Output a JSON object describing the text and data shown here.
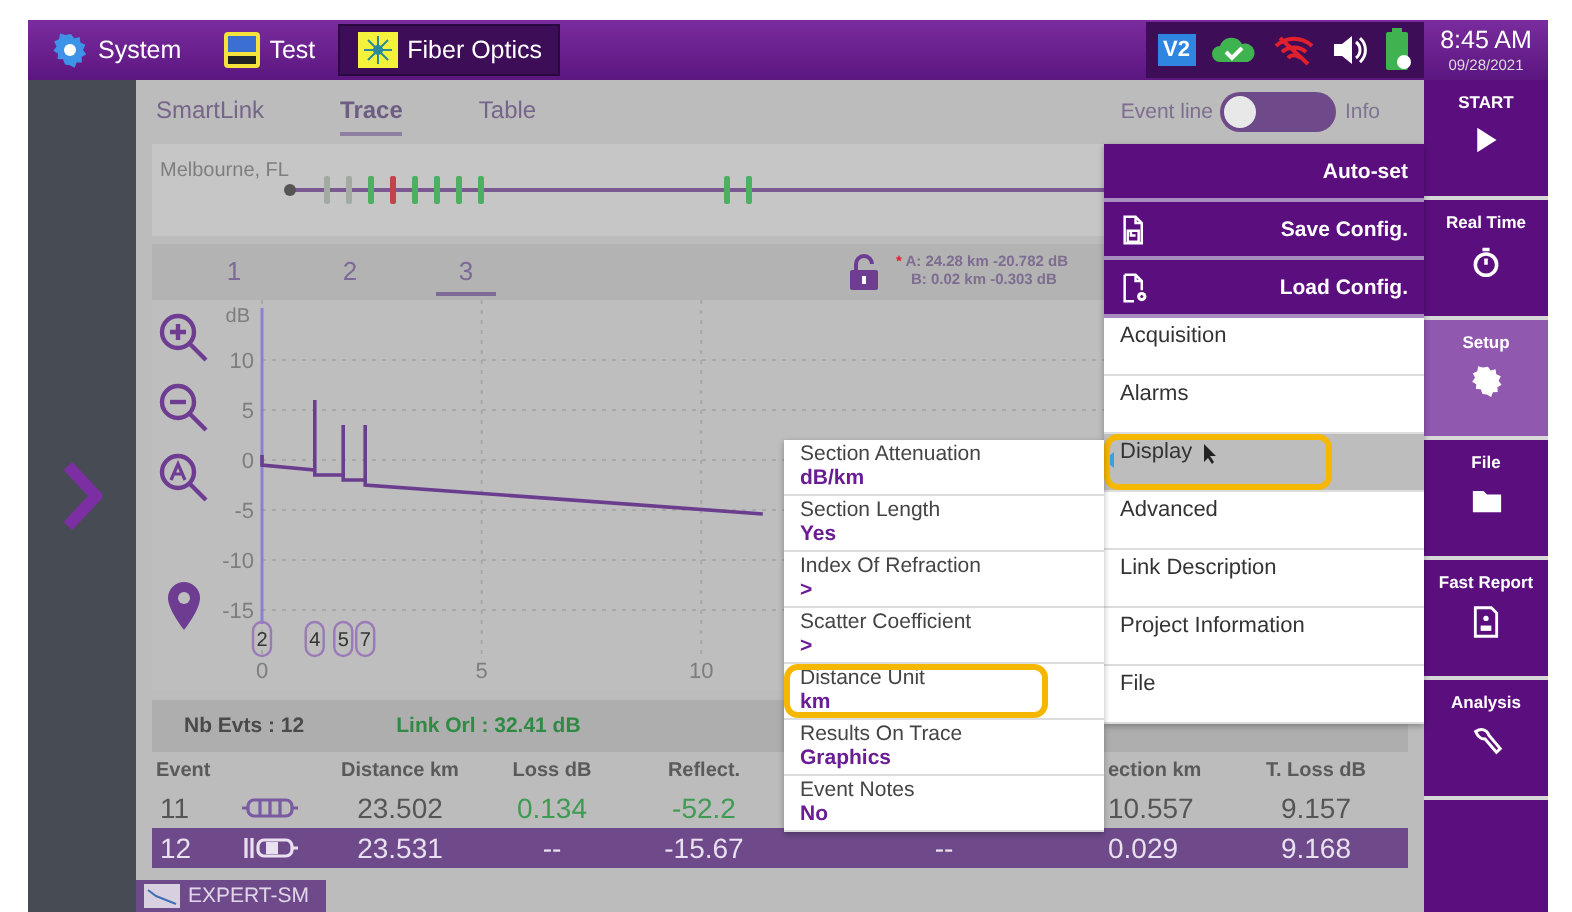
{
  "top_bar": {
    "apps": [
      {
        "label": "System",
        "selected": false
      },
      {
        "label": "Test",
        "selected": false
      },
      {
        "label": "Fiber Optics",
        "selected": true
      }
    ],
    "status": {
      "badge": "V2",
      "time": "8:45 AM",
      "date": "09/28/2021"
    }
  },
  "view_tabs": [
    {
      "label": "SmartLink",
      "selected": false
    },
    {
      "label": "Trace",
      "selected": true
    },
    {
      "label": "Table",
      "selected": false
    }
  ],
  "event_line_toggle": {
    "label": "Event line",
    "on": false,
    "info_label": "Info"
  },
  "link_map": {
    "location": "Melbourne, FL",
    "event_groups": [
      [
        {
          "color": "#a3aaa3"
        },
        {
          "color": "#a3aaa3"
        },
        {
          "color": "#4caf62"
        },
        {
          "color": "#c0444a"
        },
        {
          "color": "#4caf62"
        },
        {
          "color": "#4caf62"
        },
        {
          "color": "#4caf62"
        },
        {
          "color": "#4caf62"
        }
      ],
      [
        {
          "color": "#4caf62"
        },
        {
          "color": "#4caf62"
        }
      ]
    ]
  },
  "trace_tabs": [
    {
      "label": "1",
      "selected": false
    },
    {
      "label": "2",
      "selected": false
    },
    {
      "label": "3",
      "selected": true
    }
  ],
  "cursors": [
    {
      "marker": "*",
      "text": "A: 24.28 km -20.782 dB"
    },
    {
      "text": "B: 0.02 km -0.303 dB"
    }
  ],
  "chart_data": {
    "type": "line",
    "ylabel": "dB",
    "grid": true,
    "xlim": [
      0,
      26
    ],
    "ylim": [
      -20,
      16
    ],
    "xticks": [
      0,
      5,
      10
    ],
    "yticks": [
      10,
      5,
      0,
      -5,
      -10,
      -15
    ],
    "x": [
      0,
      0,
      1.2,
      1.2,
      1.2,
      1.85,
      1.85,
      1.85,
      2.35,
      2.35,
      2.35,
      11.4
    ],
    "series": [
      {
        "color": "#6a3d8f",
        "values": [
          0.5,
          -0.5,
          -1,
          6,
          -1.5,
          -1.5,
          3.5,
          -2,
          -2,
          3.5,
          -2.5,
          -5.4
        ]
      }
    ]
  },
  "trace_event_labels": [
    "2",
    "4",
    "5",
    "7"
  ],
  "summary": {
    "events": "Nb Evts : 12",
    "link_orl": "Link Orl : 32.41 dB"
  },
  "table": {
    "columns": [
      "Event",
      "Distance  km",
      "Loss dB",
      "Reflect.",
      null,
      "ection km",
      "T. Loss dB"
    ],
    "rows": [
      {
        "kind": "connector",
        "pass": true,
        "selected": false,
        "cells": [
          "11",
          "23.502",
          "0.134",
          "-52.2",
          null,
          "10.557",
          "9.157"
        ]
      },
      {
        "kind": "end",
        "pass": false,
        "selected": true,
        "cells": [
          "12",
          "23.531",
          "--",
          "-15.67",
          "--",
          "0.029",
          "9.168"
        ]
      }
    ]
  },
  "bottom_tab": {
    "label": "EXPERT-SM"
  },
  "side_buttons": [
    {
      "label": "START",
      "selected": false
    },
    {
      "label": "Real Time",
      "selected": false
    },
    {
      "label": "Setup",
      "selected": true
    },
    {
      "label": "File",
      "selected": false
    },
    {
      "label": "Fast Report",
      "selected": false
    },
    {
      "label": "Analysis",
      "selected": false
    }
  ],
  "setup_menu": {
    "actions": [
      {
        "label": "Auto-set"
      },
      {
        "label": "Save Config."
      },
      {
        "label": "Load Config."
      }
    ],
    "items": [
      {
        "label": "Acquisition",
        "selected": false,
        "highlighted": false
      },
      {
        "label": "Alarms",
        "selected": false,
        "highlighted": false
      },
      {
        "label": "Display",
        "selected": true,
        "highlighted": true
      },
      {
        "label": "Advanced",
        "selected": false,
        "highlighted": false
      },
      {
        "label": "Link Description",
        "selected": false,
        "highlighted": false
      },
      {
        "label": "Project Information",
        "selected": false,
        "highlighted": false
      },
      {
        "label": "File",
        "selected": false,
        "highlighted": false
      }
    ]
  },
  "display_menu": {
    "items": [
      {
        "label": "Section Attenuation",
        "value": "dB/km",
        "highlighted": false
      },
      {
        "label": "Section Length",
        "value": "Yes",
        "highlighted": false
      },
      {
        "label": "Index Of Refraction",
        "value": ">",
        "highlighted": false
      },
      {
        "label": "Scatter Coefficient",
        "value": ">",
        "highlighted": false
      },
      {
        "label": "Distance Unit",
        "value": "km",
        "highlighted": true
      },
      {
        "label": "Results On Trace",
        "value": "Graphics",
        "highlighted": false
      },
      {
        "label": "Event Notes",
        "value": "No",
        "highlighted": false
      }
    ]
  }
}
